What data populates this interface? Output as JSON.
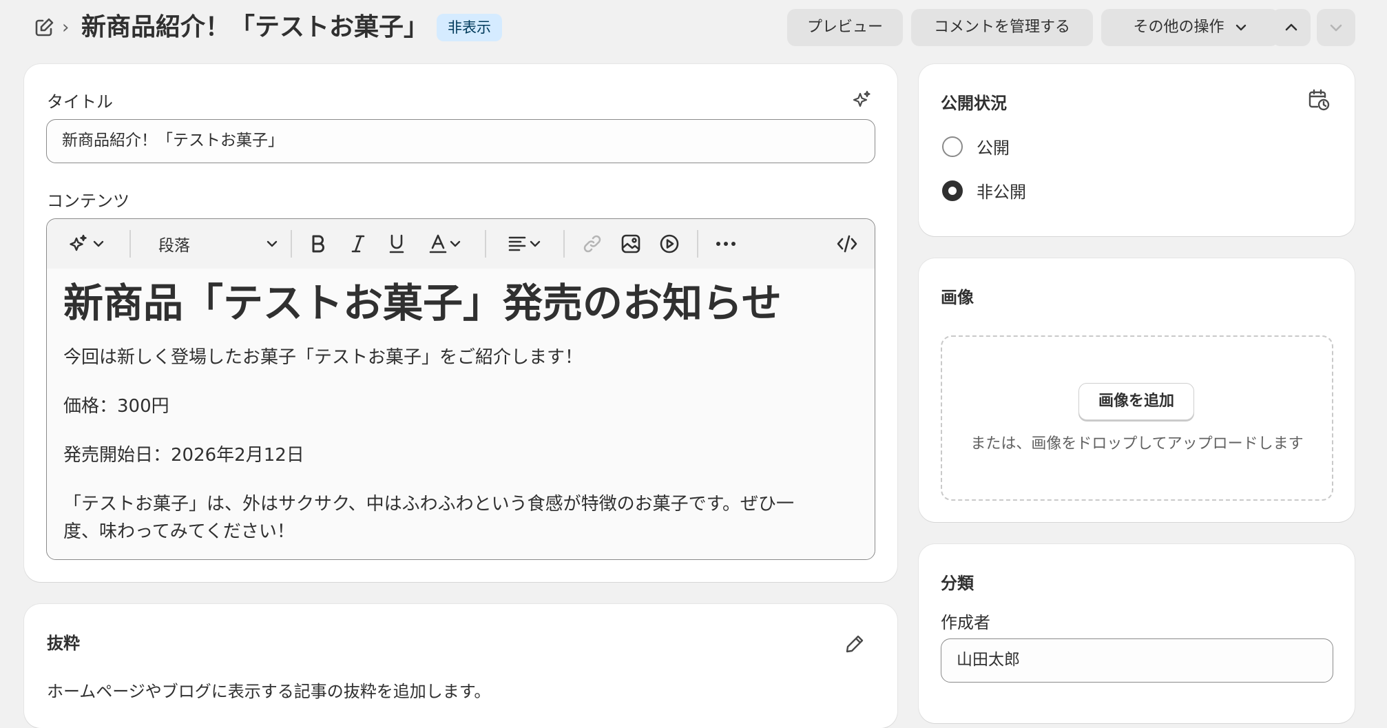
{
  "header": {
    "title": "新商品紹介！「テストお菓子」",
    "separator": "›",
    "status_badge": "非表示",
    "buttons": {
      "preview": "プレビュー",
      "manage_comments": "コメントを管理する",
      "more_actions": "その他の操作"
    }
  },
  "main": {
    "title_label": "タイトル",
    "title_value": "新商品紹介！「テストお菓子」",
    "content_label": "コンテンツ",
    "toolbar": {
      "paragraph_format": "段落"
    },
    "content": {
      "heading": "新商品「テストお菓子」発売のお知らせ",
      "paragraphs": [
        "今回は新しく登場したお菓子「テストお菓子」をご紹介します！",
        "価格：300円",
        "発売開始日：2026年2月12日",
        "「テストお菓子」は、外はサクサク、中はふわふわという食感が特徴のお菓子です。ぜひ一",
        "度、味わってみてください！"
      ]
    },
    "excerpt": {
      "heading": "抜粋",
      "description": "ホームページやブログに表示する記事の抜粋を追加します。"
    }
  },
  "sidebar": {
    "visibility": {
      "heading": "公開状況",
      "options": [
        "公開",
        "非公開"
      ],
      "selected": "非公開"
    },
    "image": {
      "heading": "画像",
      "add_button": "画像を追加",
      "drop_hint": "または、画像をドロップしてアップロードします"
    },
    "organization": {
      "heading": "分類",
      "author_label": "作成者",
      "author_value": "山田太郎"
    }
  },
  "colors": {
    "badge_bg": "#d5ebff",
    "page_bg": "#f1f1f1"
  }
}
